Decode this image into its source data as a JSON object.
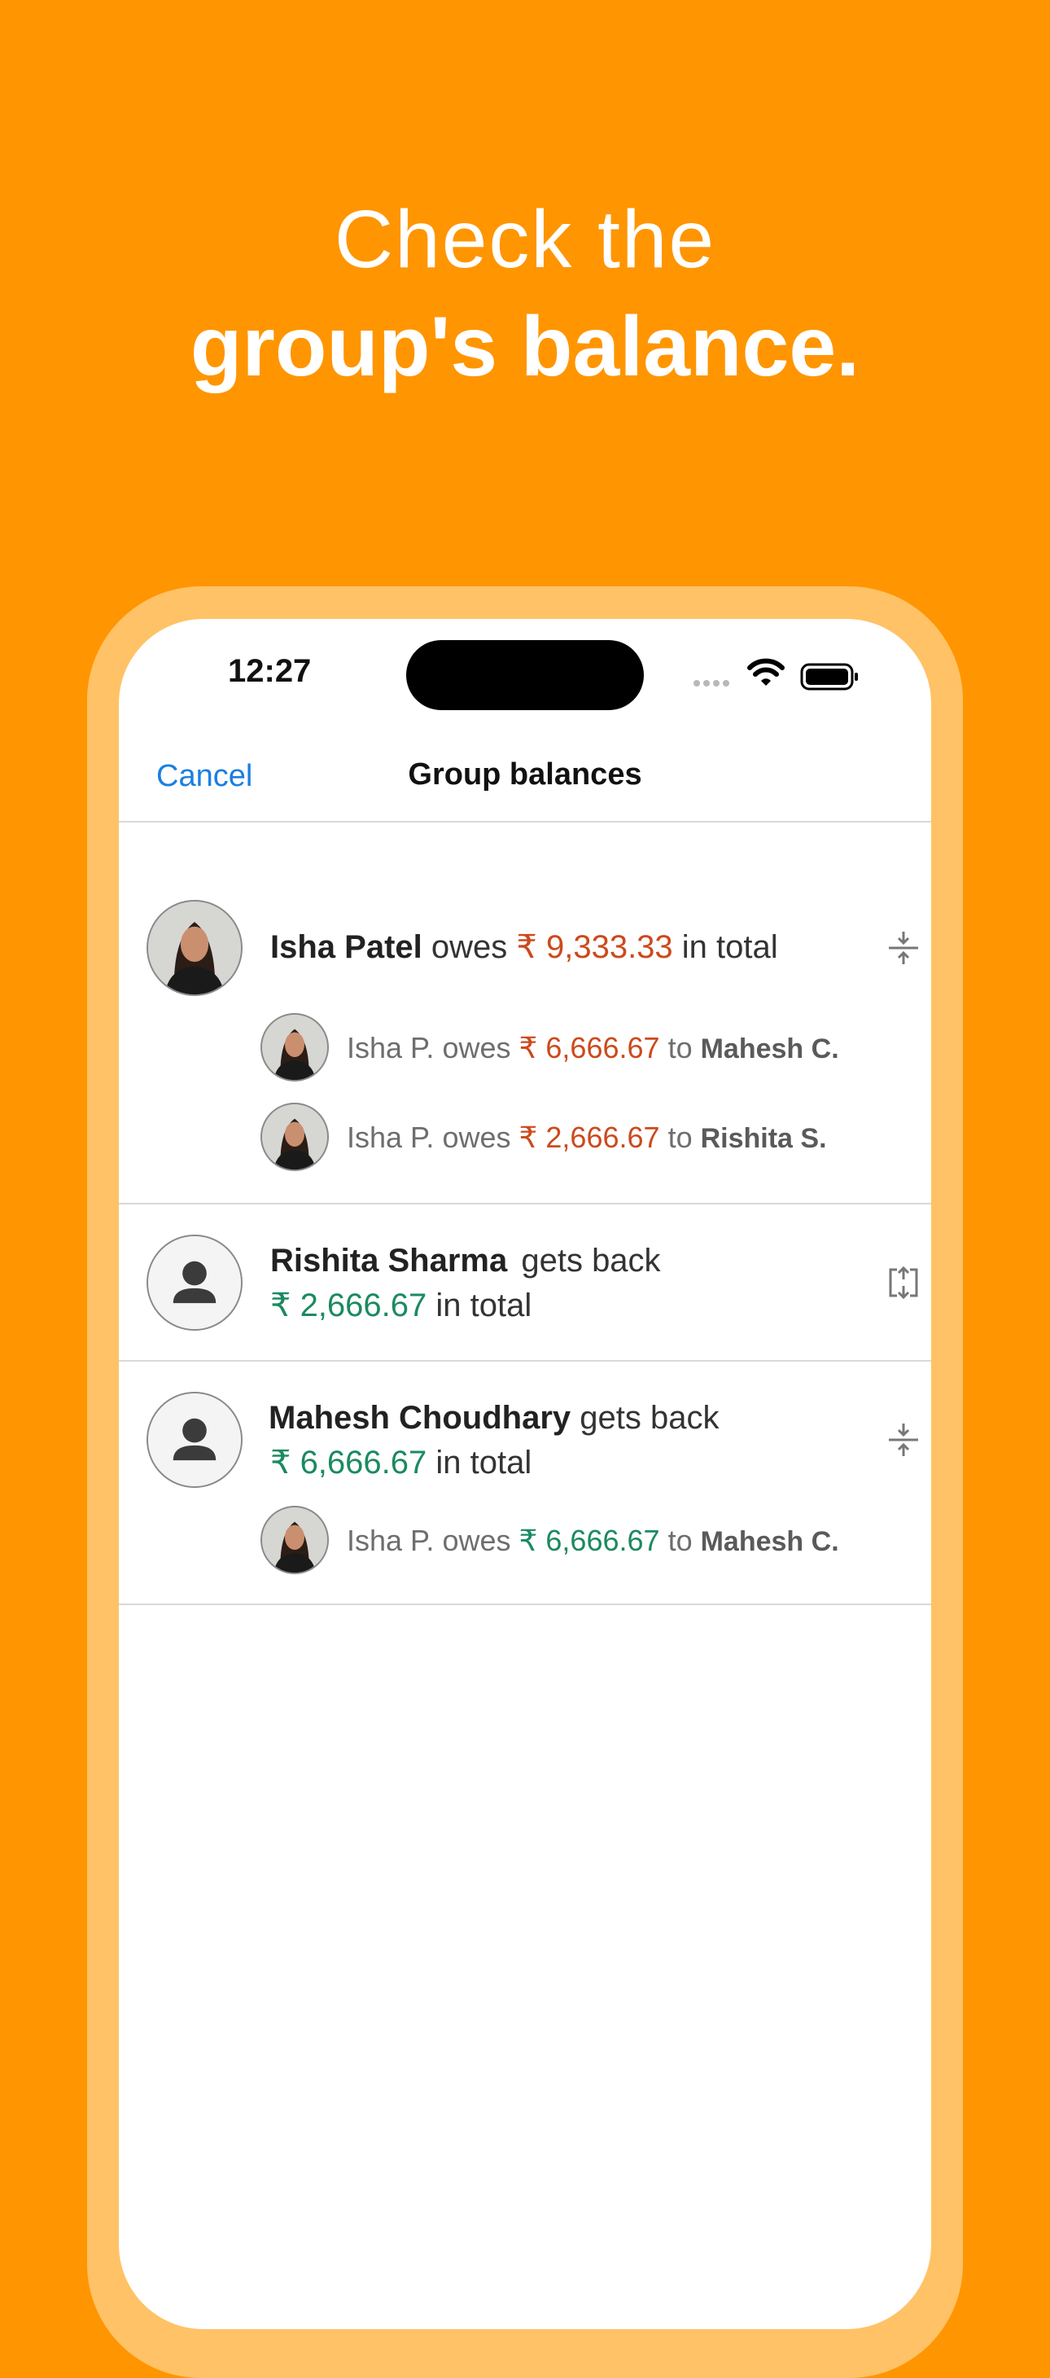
{
  "headline": {
    "line1": "Check the",
    "line2": "group's balance."
  },
  "status_bar": {
    "time": "12:27"
  },
  "navbar": {
    "cancel_label": "Cancel",
    "title": "Group balances"
  },
  "members": [
    {
      "name": "Isha Patel",
      "verb": "owes",
      "amount": "₹ 9,333.33",
      "suffix": "in total",
      "action_icon": "collapse-icon",
      "details": [
        {
          "who": "Isha P.",
          "verb": "owes",
          "amount": "₹ 6,666.67",
          "to": "to",
          "target": "Mahesh C."
        },
        {
          "who": "Isha P.",
          "verb": "owes",
          "amount": "₹ 2,666.67",
          "to": "to",
          "target": "Rishita S."
        }
      ]
    },
    {
      "name": "Rishita Sharma",
      "verb": "gets back",
      "amount": "₹ 2,666.67",
      "suffix": "in total",
      "action_icon": "expand-icon"
    },
    {
      "name": "Mahesh Choudhary",
      "verb": "gets back",
      "amount": "₹ 6,666.67",
      "suffix": "in total",
      "action_icon": "collapse-icon",
      "details": [
        {
          "who": "Isha P.",
          "verb": "owes",
          "amount": "₹ 6,666.67",
          "to": "to",
          "target": "Mahesh C."
        }
      ]
    }
  ],
  "colors": {
    "background": "#FF9500",
    "owes": "#cc4a1c",
    "gets_back": "#1b8a60",
    "link": "#1a7fe0"
  }
}
